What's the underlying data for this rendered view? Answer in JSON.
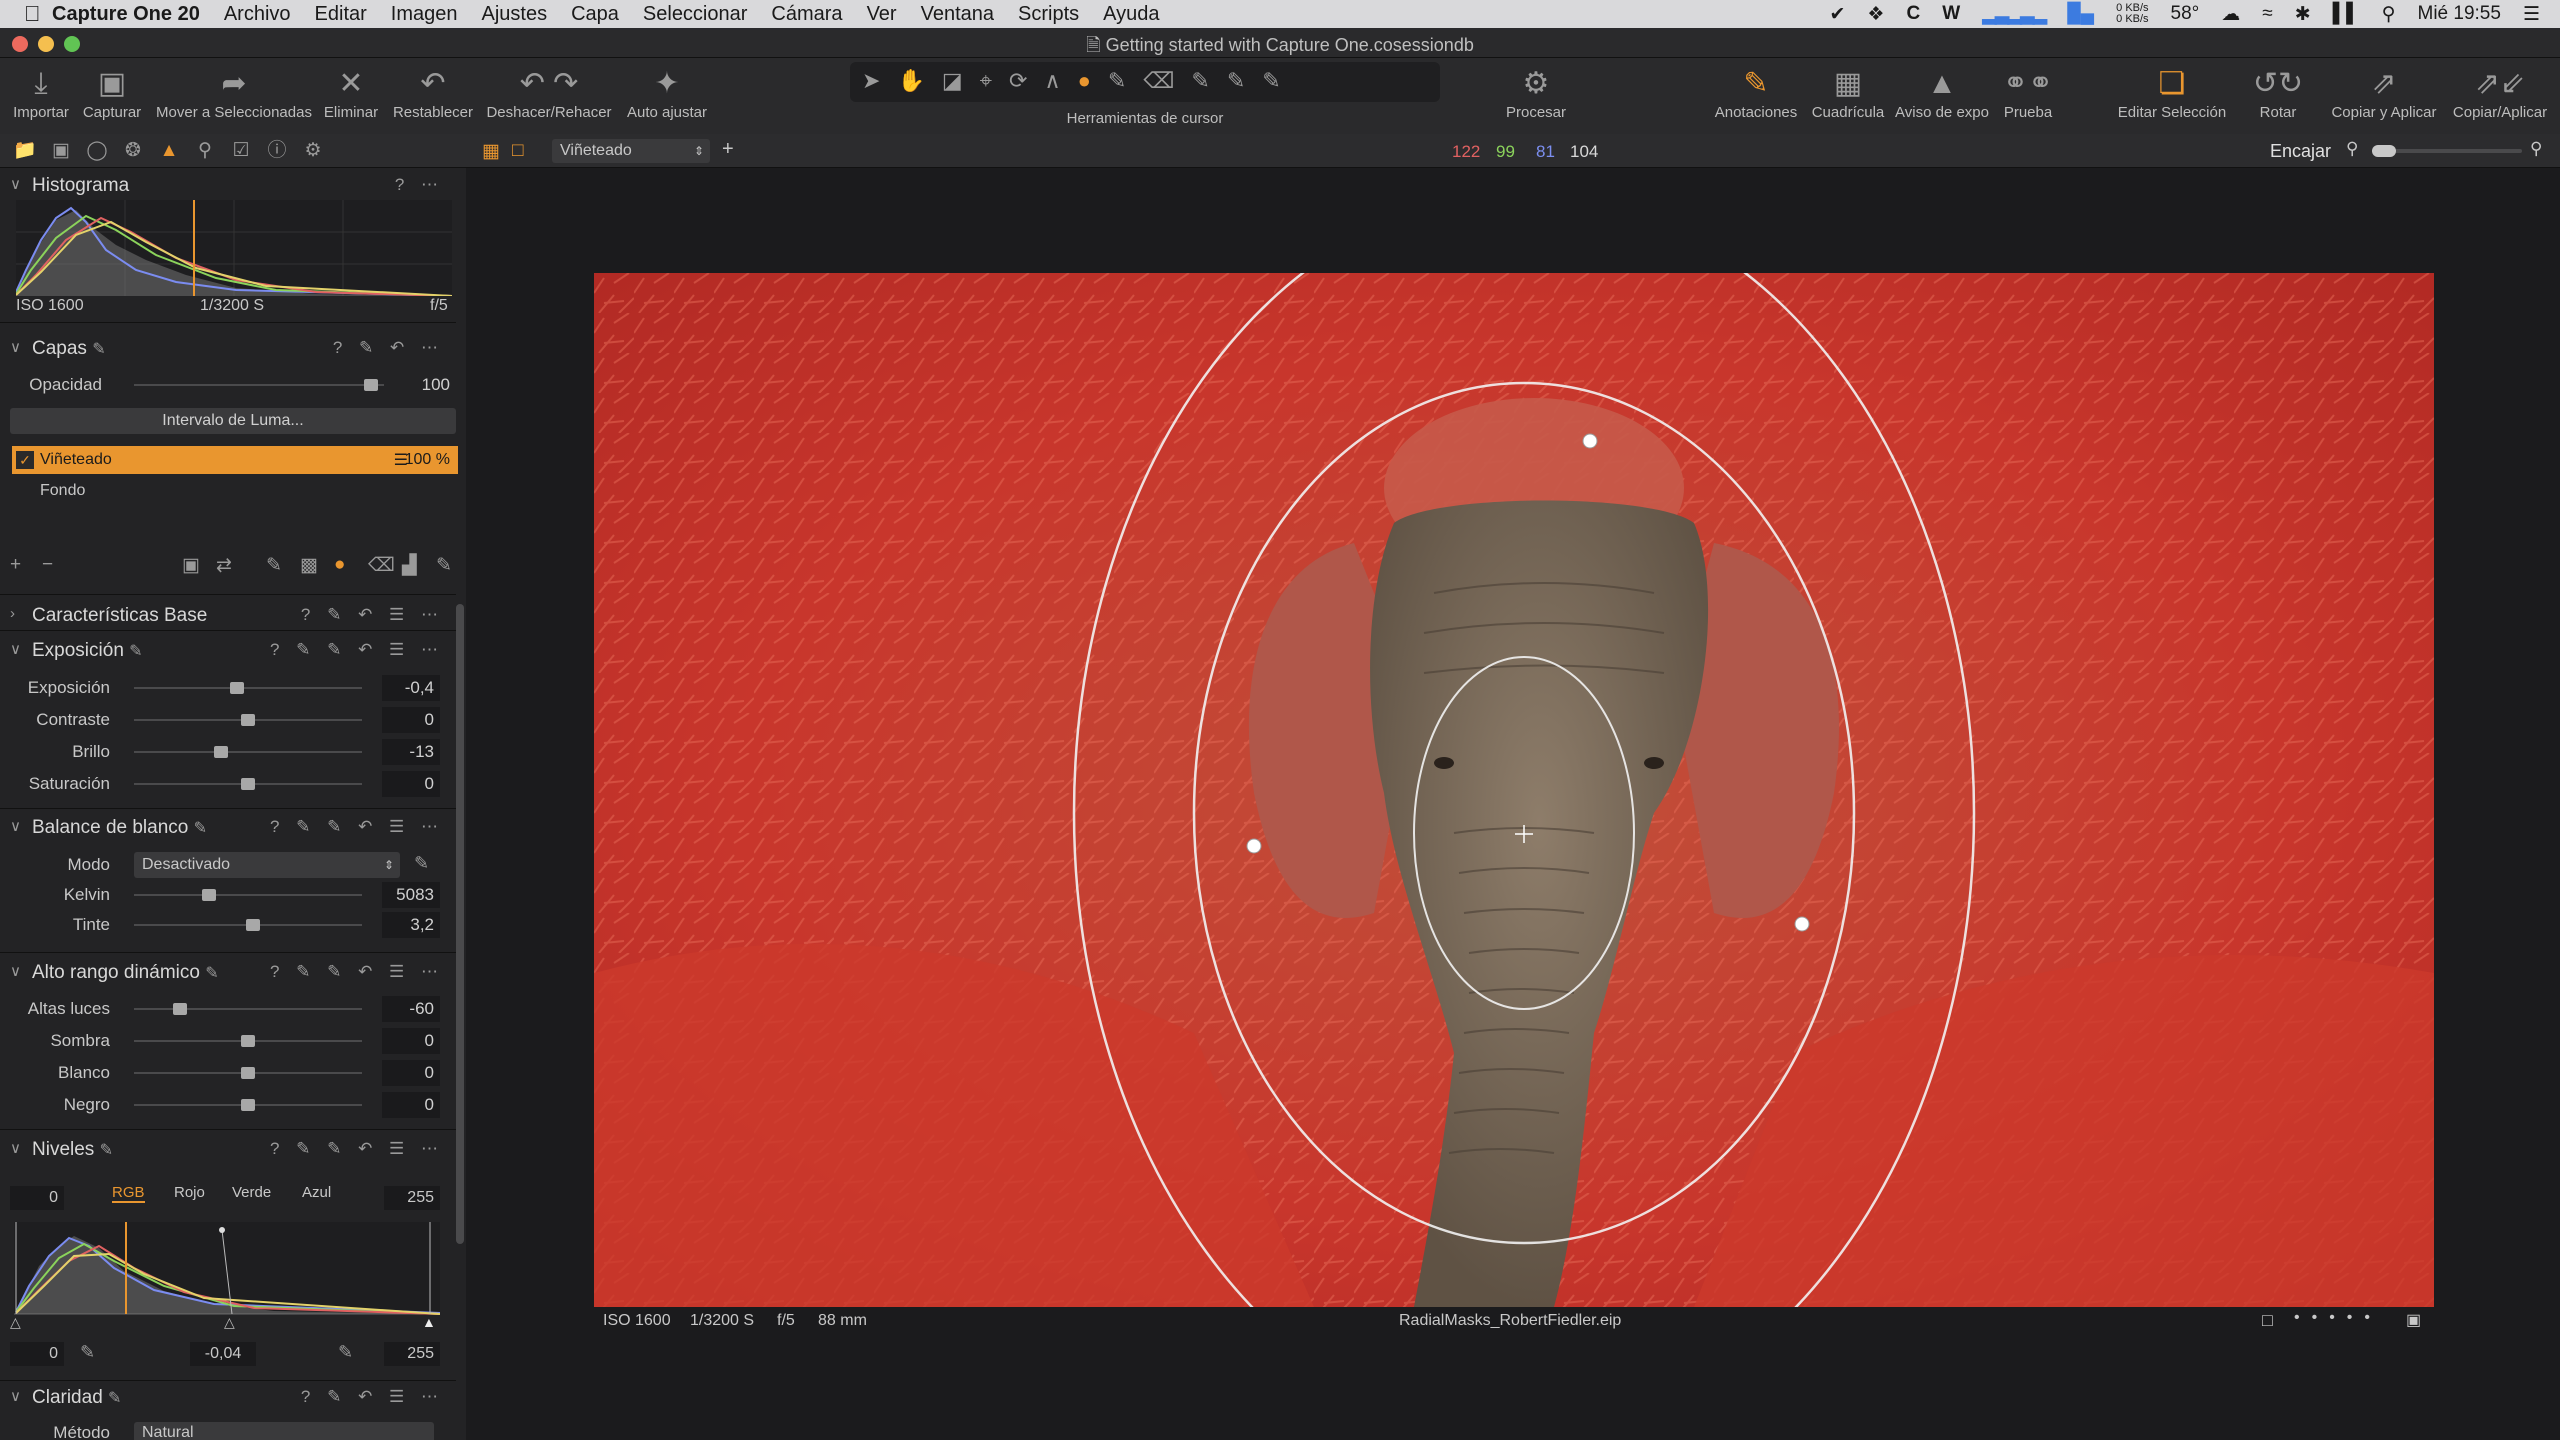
{
  "menubar": {
    "app_name": "Capture One 20",
    "items": [
      "Archivo",
      "Editar",
      "Imagen",
      "Ajustes",
      "Capa",
      "Seleccionar",
      "Cámara",
      "Ver",
      "Ventana",
      "Scripts",
      "Ayuda"
    ],
    "net_up": "0 KB/s",
    "net_down": "0 KB/s",
    "temperature": "58°",
    "clock": "Mié 19:55"
  },
  "window": {
    "title": "Getting started with Capture One.cosessiondb"
  },
  "toolbar": {
    "left_buttons": [
      "Importar",
      "Capturar",
      "Mover a Seleccionadas",
      "Eliminar",
      "Restablecer",
      "Deshacer/Rehacer",
      "Auto ajustar"
    ],
    "cursor_tools_label": "Herramientas de cursor",
    "process_label": "Procesar",
    "right_buttons": [
      "Anotaciones",
      "Cuadrícula",
      "Aviso de expo",
      "Prueba",
      "Editar Selección",
      "Rotar",
      "Copiar y Aplicar",
      "Copiar/Aplicar"
    ]
  },
  "histogram": {
    "title": "Histograma",
    "iso": "ISO 1600",
    "shutter": "1/3200 S",
    "aperture": "f/5"
  },
  "layers": {
    "title": "Capas",
    "opacity_label": "Opacidad",
    "opacity_value": "100",
    "luma_button": "Intervalo de Luma...",
    "active_layer": "Viñeteado",
    "active_layer_pct": "100 %",
    "background_layer": "Fondo"
  },
  "base_chars": {
    "title": "Características Base"
  },
  "exposure": {
    "title": "Exposición",
    "rows": [
      {
        "label": "Exposición",
        "value": "-0,4",
        "pos": 0.45
      },
      {
        "label": "Contraste",
        "value": "0",
        "pos": 0.5
      },
      {
        "label": "Brillo",
        "value": "-13",
        "pos": 0.38
      },
      {
        "label": "Saturación",
        "value": "0",
        "pos": 0.5
      }
    ]
  },
  "white_balance": {
    "title": "Balance de blanco",
    "mode_label": "Modo",
    "mode_value": "Desactivado",
    "rows": [
      {
        "label": "Kelvin",
        "value": "5083",
        "pos": 0.33
      },
      {
        "label": "Tinte",
        "value": "3,2",
        "pos": 0.52
      }
    ]
  },
  "hdr": {
    "title": "Alto rango dinámico",
    "rows": [
      {
        "label": "Altas luces",
        "value": "-60",
        "pos": 0.2
      },
      {
        "label": "Sombra",
        "value": "0",
        "pos": 0.5
      },
      {
        "label": "Blanco",
        "value": "0",
        "pos": 0.5
      },
      {
        "label": "Negro",
        "value": "0",
        "pos": 0.5
      }
    ]
  },
  "levels": {
    "title": "Niveles",
    "low": "0",
    "high": "255",
    "channels": [
      "RGB",
      "Rojo",
      "Verde",
      "Azul"
    ],
    "out_low": "0",
    "mid": "-0,04",
    "out_high": "255"
  },
  "clarity": {
    "title": "Claridad",
    "method_label": "Método",
    "method_value": "Natural"
  },
  "viewer": {
    "layer_select": "Viñeteado",
    "readout_r": "122",
    "readout_g": "99",
    "readout_b": "81",
    "readout_l": "104",
    "fit_label": "Encajar",
    "iso": "ISO 1600",
    "shutter": "1/3200 S",
    "aperture": "f/5",
    "focal": "88 mm",
    "filename": "RadialMasks_RobertFiedler.eip"
  },
  "colors": {
    "accent": "#e9962f",
    "mask": "#d8392c",
    "readout_r": "#e06161",
    "readout_g": "#8bd35b",
    "readout_b": "#7c8ff0"
  }
}
